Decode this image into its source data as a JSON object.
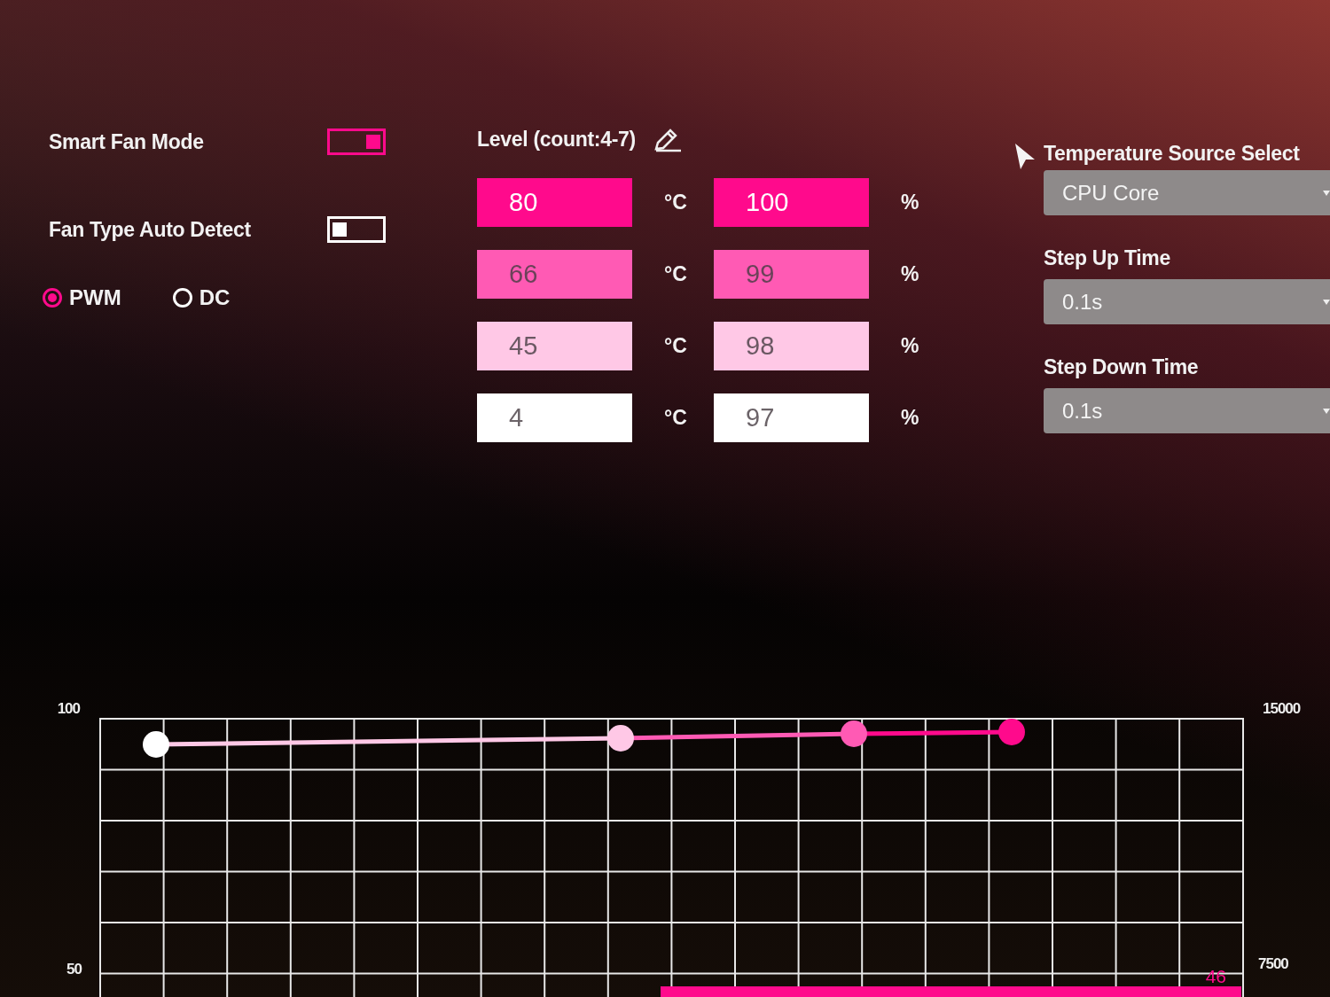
{
  "fan_settings": {
    "toggles": [
      {
        "label": "Smart Fan Mode",
        "on": true
      },
      {
        "label": "Fan Type Auto Detect",
        "on": false
      }
    ],
    "fan_type": [
      {
        "label": "PWM",
        "selected": true
      },
      {
        "label": "DC",
        "selected": false
      }
    ]
  },
  "levels": {
    "title": "Level (count:4-7)",
    "rows": [
      {
        "temperature": "80",
        "temp_unit": "°C",
        "speed": "100",
        "speed_unit": "%",
        "color": "#ff0a8c"
      },
      {
        "temperature": "66",
        "temp_unit": "°C",
        "speed": "99",
        "speed_unit": "%",
        "color": "#ff5ab4"
      },
      {
        "temperature": "45",
        "temp_unit": "°C",
        "speed": "98",
        "speed_unit": "%",
        "color": "#ffc8e6"
      },
      {
        "temperature": "4",
        "temp_unit": "°C",
        "speed": "97",
        "speed_unit": "%",
        "color": "#ffffff"
      }
    ]
  },
  "options": [
    {
      "label": "Temperature Source Select",
      "value": "CPU Core"
    },
    {
      "label": "Step Up Time",
      "value": "0.1s"
    },
    {
      "label": "Step Down Time",
      "value": "0.1s"
    }
  ],
  "fan_graph": {
    "left_axis": [
      "100",
      "50"
    ],
    "right_axis": [
      "15000",
      "7500"
    ],
    "current_reading": "46"
  }
}
